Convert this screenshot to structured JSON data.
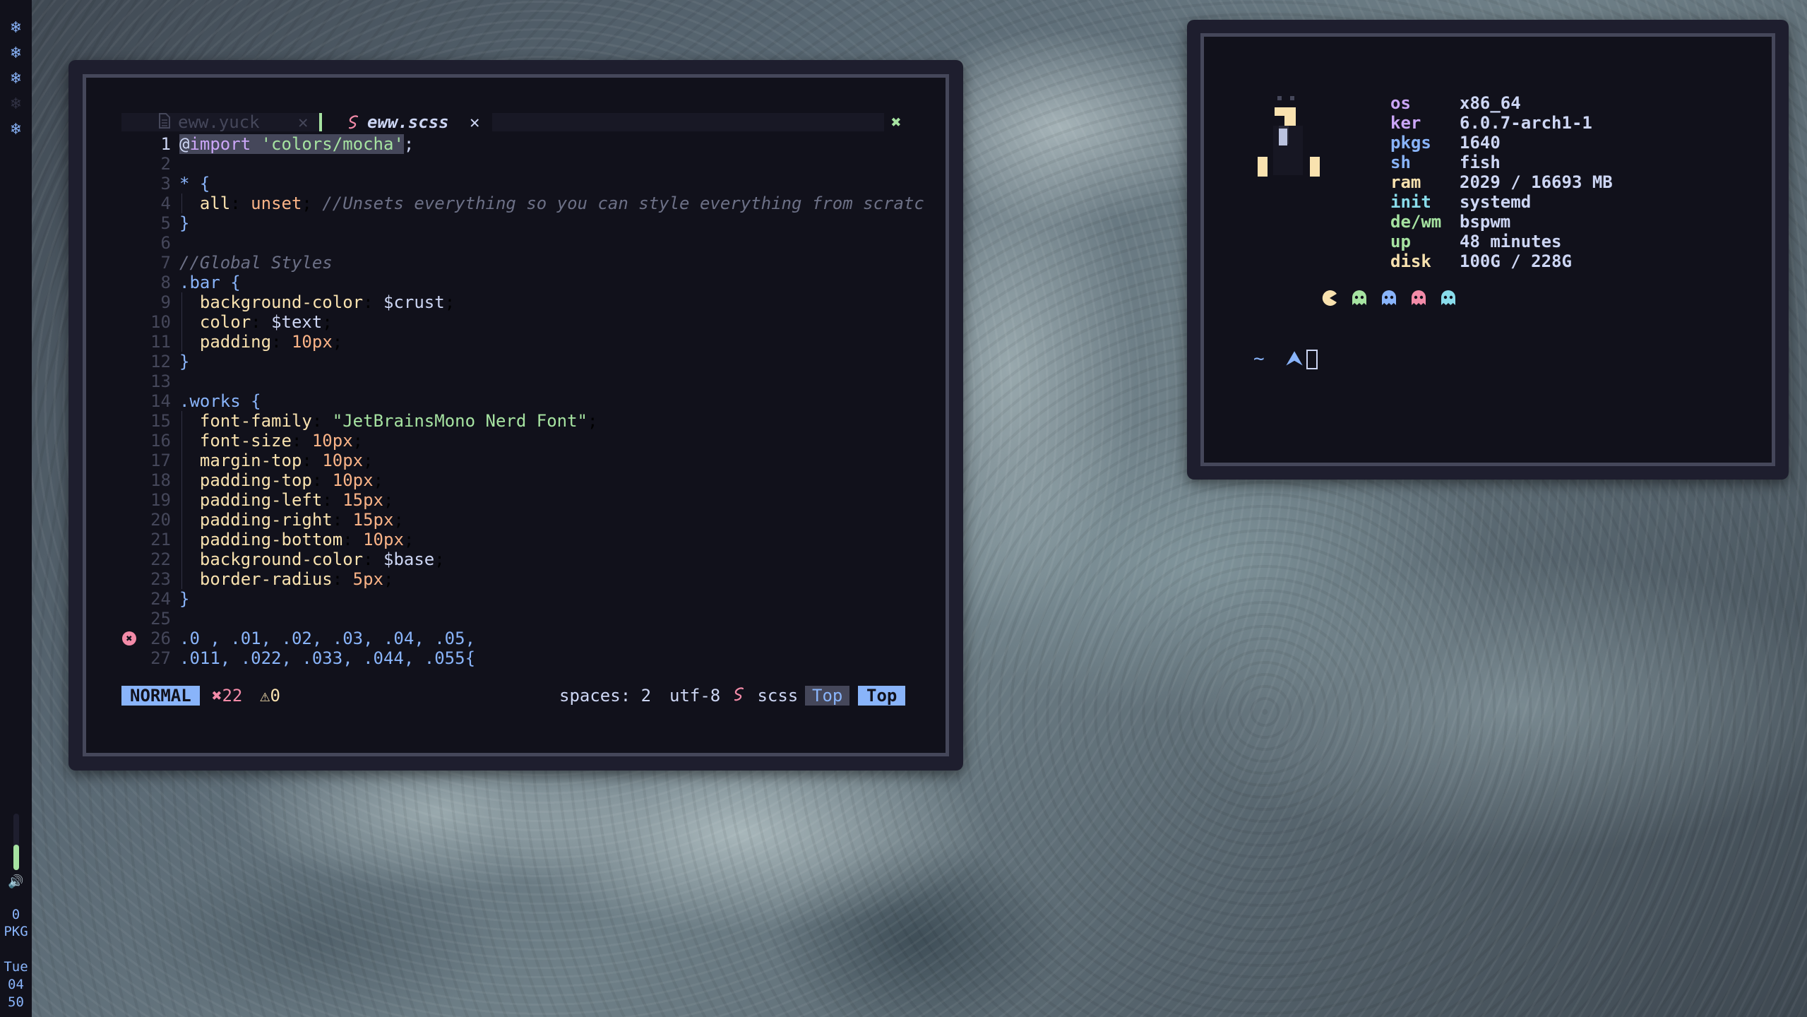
{
  "colors": {
    "base": "#1e1e2e",
    "crust": "#11111b",
    "text": "#cdd6f4",
    "blue": "#89b4fa",
    "green": "#a6e3a1",
    "red": "#f38ba8",
    "yellow": "#f9e2af",
    "peach": "#fab387",
    "mauve": "#cba6f7",
    "surface": "#45475a"
  },
  "bar": {
    "workspaces": [
      {
        "icon": "❄",
        "state": "occupied"
      },
      {
        "icon": "❄",
        "state": "occupied"
      },
      {
        "icon": "❄",
        "state": "occupied"
      },
      {
        "icon": "❄",
        "state": "empty"
      },
      {
        "icon": "❄",
        "state": "occupied"
      }
    ],
    "volume_level": 0.45,
    "volume_icon": "🔊",
    "pkg_count": "0",
    "pkg_label": "PKG",
    "clock": {
      "day": "Tue",
      "hour": "04",
      "minute": "50"
    }
  },
  "editor": {
    "tabs": [
      {
        "name": "eww.yuck",
        "icon": "file-icon",
        "close": "✕",
        "active": false
      },
      {
        "name": "eww.scss",
        "icon": "sass-icon",
        "close": "✕",
        "active": true
      }
    ],
    "close_all": "✖",
    "lines": [
      {
        "n": "1"
      },
      {
        "n": "2"
      },
      {
        "n": "3"
      },
      {
        "n": "4"
      },
      {
        "n": "5"
      },
      {
        "n": "6"
      },
      {
        "n": "7"
      },
      {
        "n": "8"
      },
      {
        "n": "9"
      },
      {
        "n": "10"
      },
      {
        "n": "11"
      },
      {
        "n": "12"
      },
      {
        "n": "13"
      },
      {
        "n": "14"
      },
      {
        "n": "15"
      },
      {
        "n": "16"
      },
      {
        "n": "17"
      },
      {
        "n": "18"
      },
      {
        "n": "19"
      },
      {
        "n": "20"
      },
      {
        "n": "21"
      },
      {
        "n": "22"
      },
      {
        "n": "23"
      },
      {
        "n": "24"
      },
      {
        "n": "25"
      },
      {
        "n": "26"
      },
      {
        "n": "27"
      }
    ],
    "code": {
      "l1_at": "@",
      "l1_import": "import",
      "l1_str": " 'colors/mocha'",
      "l1_end": ";",
      "l3": "* {",
      "l4_prop": "all",
      "l4_val": "unset",
      "l4_comment": "//Unsets everything so you can style everything from scratc",
      "l5": "}",
      "l7": "//Global Styles",
      "l8_sel": ".bar",
      "l8_brace": " {",
      "l9_prop": "background-color",
      "l9_val": "$crust",
      "l10_prop": "color",
      "l10_val": "$text",
      "l11_prop": "padding",
      "l11_val": "10px",
      "l12": "}",
      "l14_sel": ".works",
      "l14_brace": " {",
      "l15_prop": "font-family",
      "l15_val": "\"JetBrainsMono Nerd Font\"",
      "l16_prop": "font-size",
      "l16_val": "10px",
      "l17_prop": "margin-top",
      "l17_val": "10px",
      "l18_prop": "padding-top",
      "l18_val": "10px",
      "l19_prop": "padding-left",
      "l19_val": "15px",
      "l20_prop": "padding-right",
      "l20_val": "15px",
      "l21_prop": "padding-bottom",
      "l21_val": "10px",
      "l22_prop": "background-color",
      "l22_val": "$base",
      "l23_prop": "border-radius",
      "l23_val": "5px",
      "l24": "}",
      "l26": ".0 , .01, .02, .03, .04, .05,",
      "l27": ".011, .022, .033, .044, .055{"
    },
    "diagnostic_icon": "✖",
    "status": {
      "mode": "NORMAL",
      "errors_icon": "✖",
      "errors": "22",
      "warnings_icon": "⚠",
      "warnings": "0",
      "spaces": "spaces: 2",
      "encoding": "utf-8",
      "filetype_icon": "sass-icon",
      "filetype": "scss",
      "position1": "Top",
      "position2": "Top"
    }
  },
  "fetch": {
    "rows": [
      {
        "key": "os",
        "value": "x86_64",
        "color": "#cba6f7"
      },
      {
        "key": "ker",
        "value": "6.0.7-arch1-1",
        "color": "#cba6f7"
      },
      {
        "key": "pkgs",
        "value": "1640",
        "color": "#89b4fa"
      },
      {
        "key": "sh",
        "value": "fish",
        "color": "#89b4fa"
      },
      {
        "key": "ram",
        "value": "2029 / 16693 MB",
        "color": "#f9e2af"
      },
      {
        "key": "init",
        "value": "systemd",
        "color": "#89dceb"
      },
      {
        "key": "de/wm",
        "value": "bspwm",
        "color": "#a6e3a1"
      },
      {
        "key": "up",
        "value": "48 minutes",
        "color": "#a6e3a1"
      },
      {
        "key": "disk",
        "value": "100G / 228G",
        "color": "#f9e2af"
      }
    ],
    "pacman_colors": [
      "#f9e2af",
      "#a6e3a1",
      "#89b4fa",
      "#f38ba8",
      "#89dceb"
    ],
    "prompt": {
      "dir": "~",
      "arrow": "⮝"
    }
  }
}
